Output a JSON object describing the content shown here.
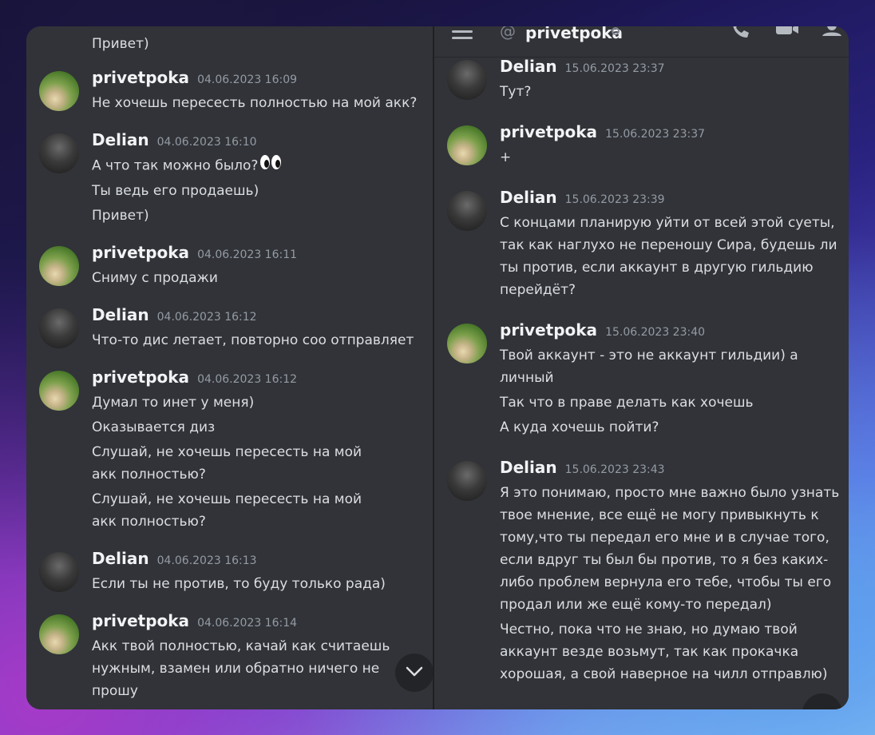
{
  "left_pane": {
    "top_partial_line": "Привет)",
    "messages": [
      {
        "user": "privetpoka",
        "time": "04.06.2023 16:09",
        "lines": [
          "Не хочешь пересесть полностью на мой акк?"
        ]
      },
      {
        "user": "Delian",
        "time": "04.06.2023 16:10",
        "lines": [
          "А что так можно было?",
          "Ты ведь его продаешь)",
          "Привет)"
        ],
        "emoji": "eyes-emoji"
      },
      {
        "user": "privetpoka",
        "time": "04.06.2023 16:11",
        "lines": [
          "Сниму с продажи"
        ]
      },
      {
        "user": "Delian",
        "time": "04.06.2023 16:12",
        "lines": [
          "Что-то дис летает, повторно соо отправляет"
        ]
      },
      {
        "user": "privetpoka",
        "time": "04.06.2023 16:12",
        "lines": [
          "Думал то инет у меня)",
          "Оказывается диз",
          "Слушай, не хочешь пересесть на мой акк полностью?",
          "Слушай, не хочешь пересесть на мой акк полностью?"
        ]
      },
      {
        "user": "Delian",
        "time": "04.06.2023 16:13",
        "lines": [
          "Если ты не против, то буду только рада)"
        ]
      },
      {
        "user": "privetpoka",
        "time": "04.06.2023 16:14",
        "lines": [
          "Акк твой полностью, качай как считаешь нужным, взамен или обратно ничего не прошу"
        ]
      }
    ],
    "scroll_down_icon": "chevron-down-icon"
  },
  "right_pane": {
    "header": {
      "at_symbol": "@",
      "channel_name": "privetpoka",
      "icons": [
        "menu-icon",
        "call-icon",
        "video-icon",
        "member-list-icon"
      ]
    },
    "messages": [
      {
        "user": "Delian",
        "time": "15.06.2023 23:37",
        "lines": [
          "Тут?"
        ]
      },
      {
        "user": "privetpoka",
        "time": "15.06.2023 23:37",
        "lines": [
          "+"
        ]
      },
      {
        "user": "Delian",
        "time": "15.06.2023 23:39",
        "lines": [
          "С концами планирую уйти от всей этой суеты, так как наглухо не переношу Сира, будешь ли ты против, если аккаунт в другую гильдию перейдёт?"
        ]
      },
      {
        "user": "privetpoka",
        "time": "15.06.2023 23:40",
        "lines": [
          "Твой аккаунт - это не аккаунт гильдии) а личный",
          "Так что в праве делать как хочешь",
          "А куда хочешь пойти?"
        ]
      },
      {
        "user": "Delian",
        "time": "15.06.2023 23:43",
        "lines": [
          "Я это понимаю, просто мне важно было узнать твое мнение, все ещё не могу привыкнуть к тому,что ты передал его мне и в случае того, если вдруг ты был бы против, то я без каких-либо проблем вернула его тебе, чтобы ты его продал или же ещё кому-то передал)",
          "Честно, пока что не знаю, но думаю твой аккаунт везде возьмут, так как прокачка хорошая, а свой наверное на чилл отправлю)"
        ]
      }
    ]
  },
  "colors": {
    "background": "#313338",
    "username": "#f2f3f5",
    "timestamp": "#949ba4",
    "text": "#dbdee1"
  }
}
